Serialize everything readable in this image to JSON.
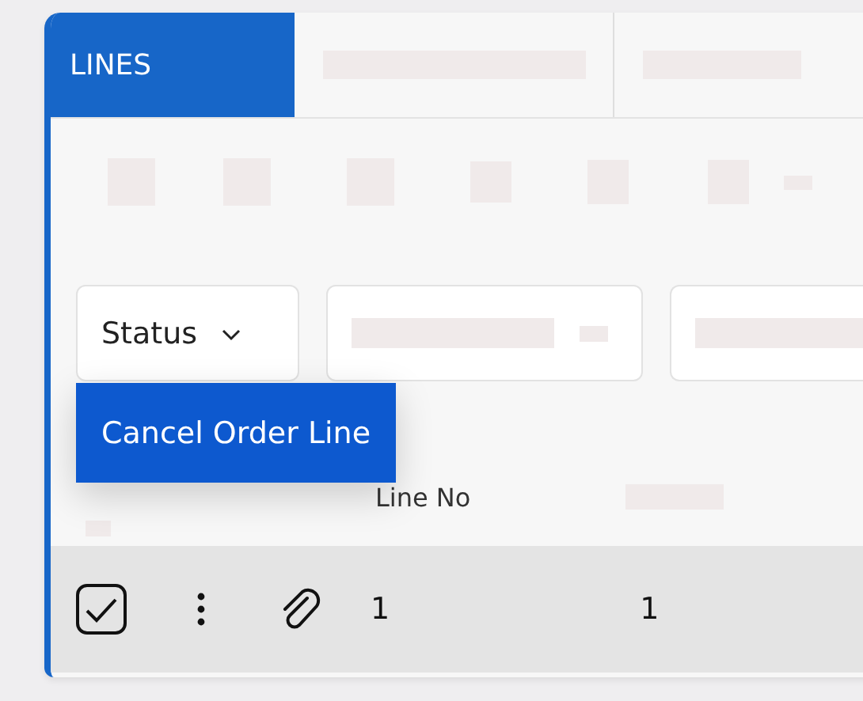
{
  "tabs": [
    {
      "label": "LINES",
      "selected": true
    },
    {
      "selected": false
    },
    {
      "selected": false
    }
  ],
  "filters": [
    {
      "kind": "dropdown",
      "label": "Status"
    },
    {
      "kind": "loading"
    },
    {
      "kind": "loading"
    }
  ],
  "menu": {
    "items": [
      {
        "label": "Cancel Order Line"
      }
    ]
  },
  "table": {
    "columns": [
      {
        "label": "Line No"
      }
    ],
    "rows": [
      {
        "checked": true,
        "cells": [
          "1",
          "1"
        ]
      }
    ]
  }
}
